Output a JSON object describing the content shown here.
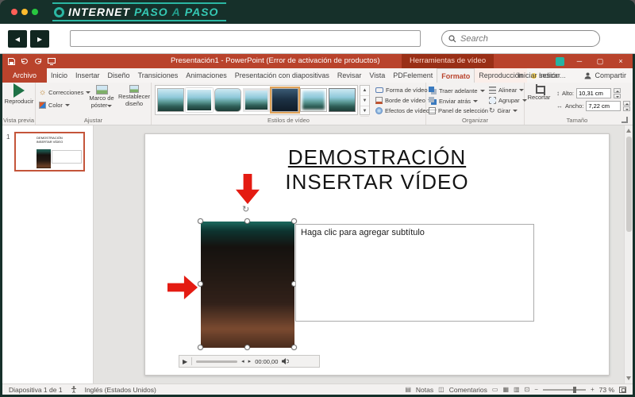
{
  "chrome": {
    "logo_word1": "INTERNET",
    "logo_word2": "PASO",
    "logo_word3": "A",
    "logo_word4": "PASO",
    "search_placeholder": "Search"
  },
  "icons": {
    "back_arrow": "◂",
    "forward_arrow": "▸",
    "play": "▶",
    "step_back": "◂",
    "step_forward": "▸",
    "rotate": "↻",
    "sun": "☼",
    "height": "↕",
    "width": "↔",
    "gallery_up": "▲",
    "gallery_down": "▼",
    "gallery_more": "▼",
    "notes": "▤",
    "comments": "◫",
    "view_normal": "▭",
    "view_sorter": "▦",
    "view_reading": "▥",
    "view_slideshow": "⊡",
    "minimize": "─",
    "maximize": "▢",
    "close": "×"
  },
  "titlebar": {
    "title": "Presentación1 - PowerPoint (Error de activación de productos)",
    "context_header": "Herramientas de vídeo"
  },
  "tabs": {
    "file": "Archivo",
    "items": [
      "Inicio",
      "Insertar",
      "Diseño",
      "Transiciones",
      "Animaciones",
      "Presentación con diapositivas",
      "Revisar",
      "Vista",
      "PDFelement"
    ],
    "format": "Formato",
    "playback": "Reproducción",
    "tell_me": "Indicar...",
    "sign_in": "Iniciar sesión",
    "share": "Compartir"
  },
  "ribbon": {
    "preview": {
      "label": "Vista previa",
      "play": "Reproducir"
    },
    "adjust": {
      "label": "Ajustar",
      "corrections": "Correcciones",
      "color": "Color",
      "poster": "Marco de póster",
      "reset": "Restablecer diseño"
    },
    "styles": {
      "label": "Estilos de vídeo",
      "shape": "Forma de vídeo",
      "border": "Borde de vídeo",
      "effects": "Efectos de vídeo"
    },
    "arrange": {
      "label": "Organizar",
      "bring_forward": "Traer adelante",
      "send_backward": "Enviar atrás",
      "selection_pane": "Panel de selección",
      "align": "Alinear",
      "group": "Agrupar",
      "rotate": "Girar"
    },
    "size": {
      "label": "Tamaño",
      "crop": "Recortar",
      "height_label": "Alto:",
      "height_value": "10,31 cm",
      "width_label": "Ancho:",
      "width_value": "7,22 cm"
    }
  },
  "slides_panel": {
    "slide_number": "1"
  },
  "slide": {
    "title_line1": "DEMOSTRACIÓN",
    "title_line2": "INSERTAR VÍDEO",
    "subtitle_placeholder": "Haga clic para agregar subtítulo",
    "player_time": "00:00,00"
  },
  "statusbar": {
    "slide_info": "Diapositiva 1 de 1",
    "language": "Inglés (Estados Unidos)",
    "notes": "Notas",
    "comments": "Comentarios",
    "zoom_level": "73 %"
  }
}
